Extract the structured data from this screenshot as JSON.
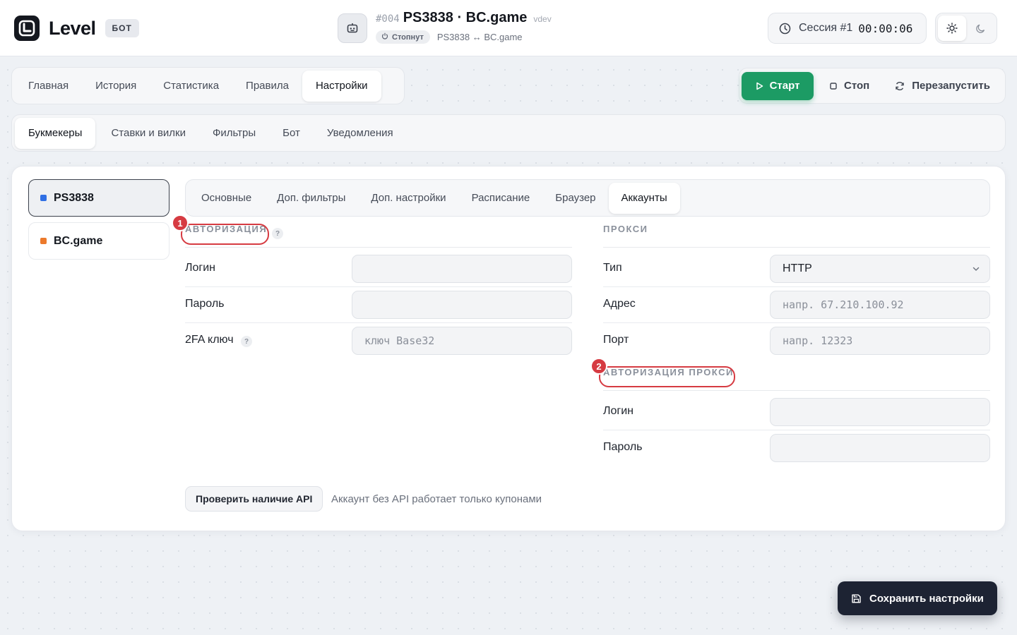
{
  "app": {
    "name": "Level",
    "badge": "БОТ"
  },
  "header": {
    "bot_id": "#004",
    "bot_title": "PS3838 · BC.game",
    "env": "vdev",
    "status": "Стопнут",
    "pair": "PS3838 ↔ BC.game",
    "session_label": "Сессия #1",
    "session_time": "00:00:06",
    "theme": "light"
  },
  "main_tabs": [
    {
      "label": "Главная",
      "active": false
    },
    {
      "label": "История",
      "active": false
    },
    {
      "label": "Статистика",
      "active": false
    },
    {
      "label": "Правила",
      "active": false
    },
    {
      "label": "Настройки",
      "active": true
    }
  ],
  "actions": {
    "start": "Старт",
    "stop": "Стоп",
    "restart": "Перезапустить"
  },
  "settings_tabs": [
    {
      "label": "Букмекеры",
      "active": true
    },
    {
      "label": "Ставки и вилки",
      "active": false
    },
    {
      "label": "Фильтры",
      "active": false
    },
    {
      "label": "Бот",
      "active": false
    },
    {
      "label": "Уведомления",
      "active": false
    }
  ],
  "bookmakers": [
    {
      "name": "PS3838",
      "color": "#2f6fe4",
      "active": true
    },
    {
      "name": "BC.game",
      "color": "#ec7a2c",
      "active": false
    }
  ],
  "bookmaker_tabs": [
    {
      "label": "Основные",
      "active": false
    },
    {
      "label": "Доп. фильтры",
      "active": false
    },
    {
      "label": "Доп. настройки",
      "active": false
    },
    {
      "label": "Расписание",
      "active": false
    },
    {
      "label": "Браузер",
      "active": false
    },
    {
      "label": "Аккаунты",
      "active": true
    }
  ],
  "auth": {
    "title": "АВТОРИЗАЦИЯ",
    "marker": "1",
    "help": "?",
    "login_label": "Логин",
    "login_value": "",
    "password_label": "Пароль",
    "password_value": "",
    "twofa_label": "2FA ключ",
    "twofa_placeholder": "ключ Base32"
  },
  "proxy": {
    "title": "ПРОКСИ",
    "type_label": "Тип",
    "type_value": "HTTP",
    "address_label": "Адрес",
    "address_placeholder": "напр. 67.210.100.92",
    "port_label": "Порт",
    "port_placeholder": "напр. 12323"
  },
  "proxy_auth": {
    "title": "АВТОРИЗАЦИЯ ПРОКСИ",
    "marker": "2",
    "login_label": "Логин",
    "login_value": "",
    "password_label": "Пароль",
    "password_value": ""
  },
  "api": {
    "button": "Проверить наличие API",
    "note": "Аккаунт без API работает только купонами"
  },
  "save_button": "Сохранить настройки",
  "colors": {
    "accent_green": "#1c9b64",
    "highlight_red": "#d63b42",
    "dark_button": "#1d2333"
  }
}
